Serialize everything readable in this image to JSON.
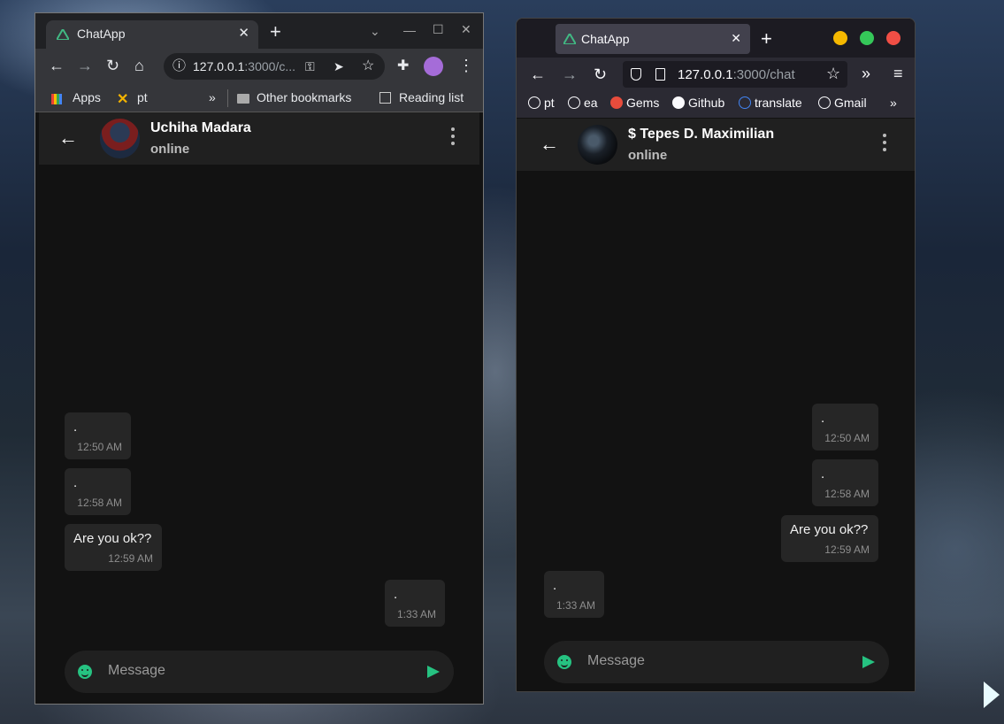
{
  "window1": {
    "tab_title": "ChatApp",
    "url_host": "127.0.0.1",
    "url_rest": ":3000/c...",
    "bookmarks": {
      "apps": "Apps",
      "pt": "pt",
      "more": "»",
      "other": "Other bookmarks",
      "reading": "Reading list"
    },
    "chat": {
      "contact_name": "Uchiha Madara",
      "status": "online",
      "messages": [
        {
          "text": ".",
          "time": "12:50 AM",
          "side": "received"
        },
        {
          "text": ".",
          "time": "12:58 AM",
          "side": "received"
        },
        {
          "text": "Are you ok??",
          "time": "12:59 AM",
          "side": "received"
        },
        {
          "text": ".",
          "time": "1:33 AM",
          "side": "sent"
        }
      ],
      "placeholder": "Message"
    }
  },
  "window2": {
    "tab_title": "ChatApp",
    "url_host": "127.0.0.1",
    "url_rest": ":3000/chat",
    "bookmarks": [
      "pt",
      "ea",
      "Gems",
      "Github",
      "translate",
      "Gmail"
    ],
    "chat": {
      "contact_name": "$ Tepes D. Maximilian",
      "status": "online",
      "messages": [
        {
          "text": ".",
          "time": "12:50 AM",
          "side": "sent"
        },
        {
          "text": ".",
          "time": "12:58 AM",
          "side": "sent"
        },
        {
          "text": "Are you ok??",
          "time": "12:59 AM",
          "side": "sent"
        },
        {
          "text": ".",
          "time": "1:33 AM",
          "side": "received"
        }
      ],
      "placeholder": "Message"
    }
  },
  "colors": {
    "accent": "#26c281",
    "background": "#121212",
    "bubble": "#262626",
    "header": "#202020"
  }
}
